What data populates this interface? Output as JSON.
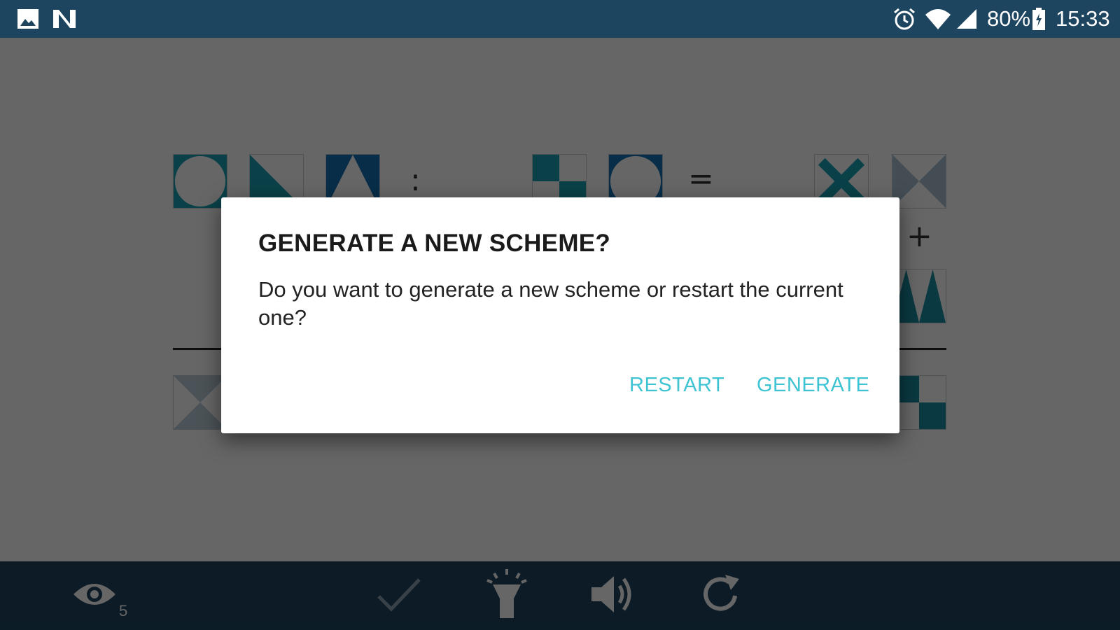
{
  "status_bar": {
    "battery": "80%",
    "time": "15:33",
    "icons": [
      "image-icon",
      "n-app-icon",
      "alarm-icon",
      "wifi-icon",
      "signal-icon",
      "battery-icon"
    ]
  },
  "puzzle": {
    "operators": {
      "divide": ":",
      "equals": "=",
      "plus": "+"
    }
  },
  "bottom_bar": {
    "hint_count": "5",
    "icons": [
      "eye-icon",
      "check-icon",
      "flashlight-icon",
      "sound-icon",
      "refresh-icon"
    ]
  },
  "dialog": {
    "title": "GENERATE A NEW SCHEME?",
    "message": "Do you want to generate a new scheme or restart the current one?",
    "restart_label": "RESTART",
    "generate_label": "GENERATE"
  },
  "colors": {
    "bar": "#1e4560",
    "accent": "#3ec3d3",
    "teal": "#1ba3b3",
    "blue": "#1672b5"
  }
}
